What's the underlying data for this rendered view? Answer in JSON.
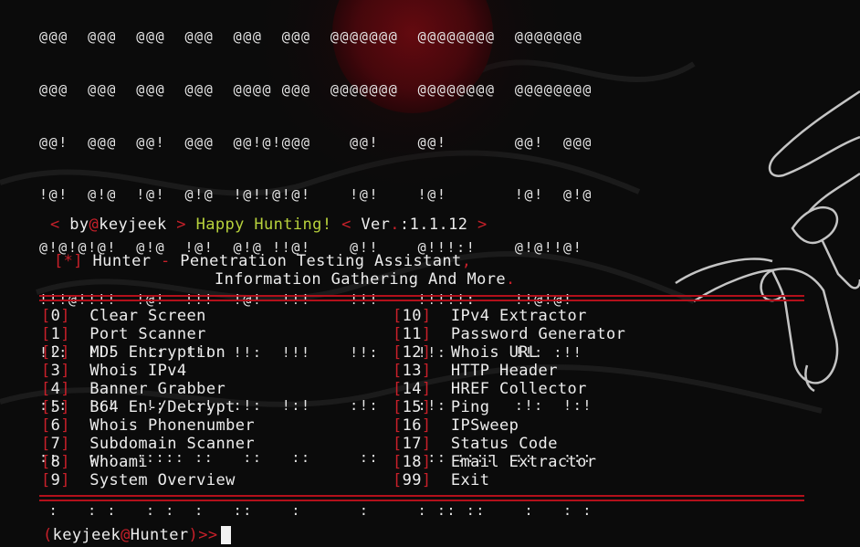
{
  "banner": {
    "lines": [
      "@@@  @@@  @@@  @@@  @@@  @@@  @@@@@@@  @@@@@@@@  @@@@@@@",
      "@@@  @@@  @@@  @@@  @@@@ @@@  @@@@@@@  @@@@@@@@  @@@@@@@@",
      "@@!  @@@  @@!  @@@  @@!@!@@@    @@!    @@!       @@!  @@@",
      "!@!  @!@  !@!  @!@  !@!!@!@!    !@!    !@!       !@!  @!@",
      "@!@!@!@!  @!@  !@!  @!@ !!@!    @!!    @!!!:!    @!@!!@!",
      "!!!@!!!!  !@!  !!!  !@!  !!!    !!!    !!!!!:    !!@!@!",
      "!!:  !!!  !!:  !!!  !!:  !!!    !!:    !!:       !!: :!!",
      ":!:  !:!  :!:  !:!  :!:  !:!    :!:    :!:       :!:  !:!",
      "::   :::  ::::: ::   ::   ::     ::     :: ::::  ::   :::",
      " :   : :   : :  :   ::    :      :     : :: ::    :   : :"
    ]
  },
  "info": {
    "lt": "<",
    "by": " by",
    "at": "@",
    "author": "keyjeek",
    "gt": ">",
    "tagline": "Happy Hunting!",
    "ver_label": "Ver",
    "ver_dot": ".",
    "ver_colon": ":",
    "version": "1.1.12"
  },
  "title": {
    "marker": "[*]",
    "name": "Hunter",
    "dash": "-",
    "line1": "Penetration Testing Assistant",
    "comma": ",",
    "line2": "Information Gathering And More",
    "period": "."
  },
  "menu": {
    "left": [
      {
        "num": "0",
        "label": "Clear Screen"
      },
      {
        "num": "1",
        "label": "Port Scanner"
      },
      {
        "num": "2",
        "label": "MD5 Encryption"
      },
      {
        "num": "3",
        "label": "Whois IPv4"
      },
      {
        "num": "4",
        "label": "Banner Grabber"
      },
      {
        "num": "5",
        "label": "B64 En-/Decrypt"
      },
      {
        "num": "6",
        "label": "Whois Phonenumber"
      },
      {
        "num": "7",
        "label": "Subdomain Scanner"
      },
      {
        "num": "8",
        "label": "Whoami"
      },
      {
        "num": "9",
        "label": "System Overview"
      }
    ],
    "right": [
      {
        "num": "10",
        "label": "IPv4 Extractor"
      },
      {
        "num": "11",
        "label": "Password Generator"
      },
      {
        "num": "12",
        "label": "Whois URL"
      },
      {
        "num": "13",
        "label": "HTTP Header"
      },
      {
        "num": "14",
        "label": "HREF Collector"
      },
      {
        "num": "15",
        "label": "Ping"
      },
      {
        "num": "16",
        "label": "IPSweep"
      },
      {
        "num": "17",
        "label": "Status Code"
      },
      {
        "num": "18",
        "label": "Email Extractor"
      },
      {
        "num": "99",
        "label": "Exit"
      }
    ]
  },
  "prompt": {
    "open": "(",
    "user": "keyjeek",
    "at": "@",
    "host": "Hunter",
    "close": ")",
    "arrows": ">>"
  },
  "colors": {
    "accent_red": "#c8202a",
    "text": "#ededed",
    "tagline": "#b8d23c",
    "background": "#0b0b0b"
  }
}
